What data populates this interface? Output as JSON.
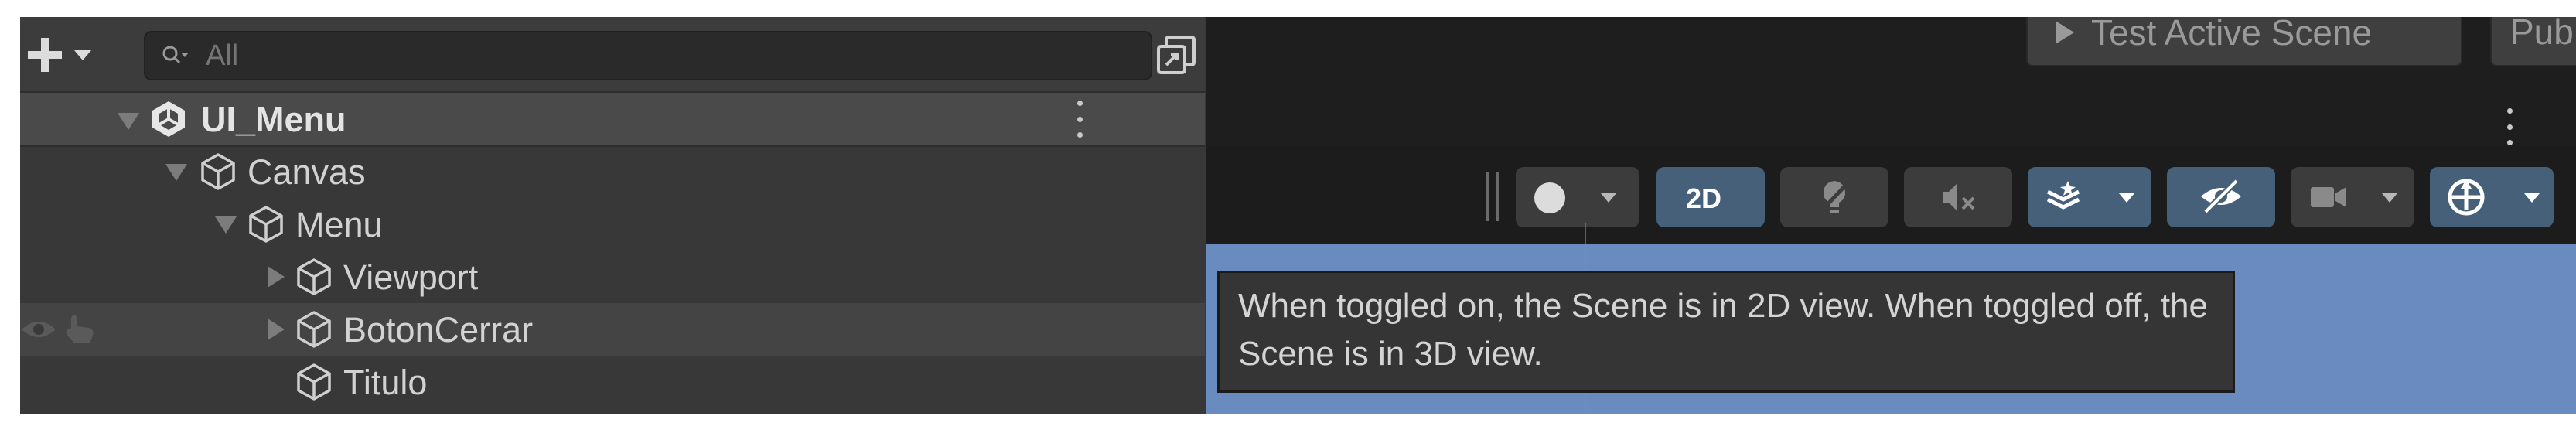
{
  "hierarchy": {
    "search": {
      "placeholder": "All"
    },
    "tree": [
      {
        "label": "UI_Menu",
        "expanded": true,
        "kind": "scene"
      },
      {
        "label": "Canvas",
        "expanded": true,
        "kind": "gameobject"
      },
      {
        "label": "Menu",
        "expanded": true,
        "kind": "gameobject"
      },
      {
        "label": "Viewport",
        "expanded": false,
        "kind": "gameobject"
      },
      {
        "label": "BotonCerrar",
        "expanded": false,
        "kind": "gameobject"
      },
      {
        "label": "Titulo",
        "expanded": null,
        "kind": "gameobject"
      }
    ]
  },
  "scene": {
    "play_button": "Test Active Scene",
    "publish_button": "Publ",
    "toolbar": {
      "view_2d": "2D",
      "view_2d_active": true
    },
    "tooltip": "When toggled on, the Scene is in 2D view. When toggled off, the Scene is in 3D view."
  },
  "colors": {
    "panel_bg": "#383838",
    "selected_row": "#4a4a4a",
    "active_toggle": "#46607a",
    "viewport_bg": "#6a8bbf",
    "tooltip_bg": "#353535"
  },
  "icons": [
    "plus-icon",
    "search-icon",
    "scene-picker-icon",
    "unity-scene-icon",
    "gameobject-cube-icon",
    "visibility-eye-icon",
    "pickable-hand-icon",
    "shading-mode-icon",
    "lighting-icon",
    "audio-mute-icon",
    "effects-icon",
    "hidden-objects-icon",
    "camera-icon",
    "gizmos-icon",
    "kebab-menu-icon",
    "play-icon"
  ]
}
